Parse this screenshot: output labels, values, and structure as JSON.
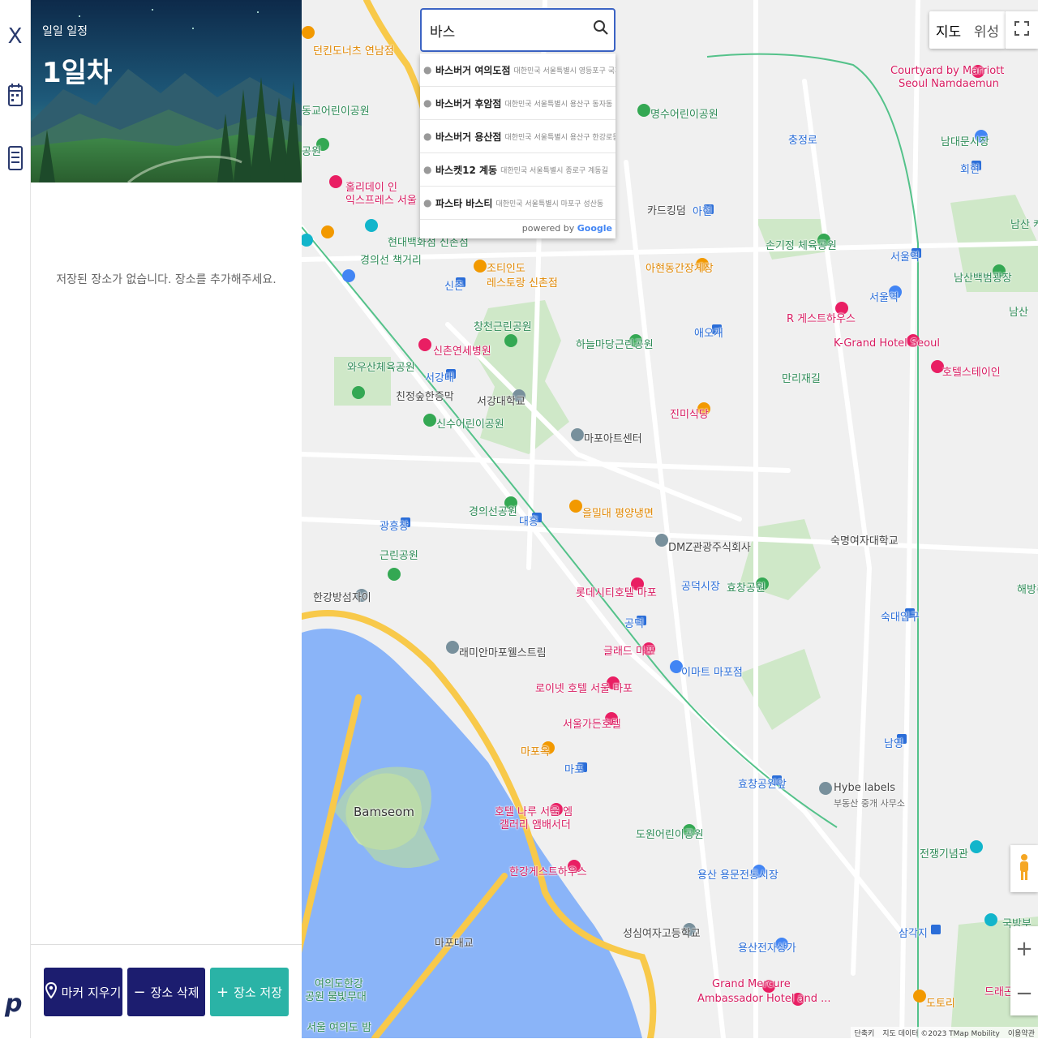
{
  "rail": {
    "close_label": "X",
    "logo": "p"
  },
  "panel": {
    "subtitle": "일일 일정",
    "title": "1일차",
    "empty_message": "저장된 장소가 없습니다. 장소를 추가해주세요.",
    "buttons": {
      "clear_markers": "마커 지우기",
      "delete_place": "장소 삭제",
      "save_place": "장소 저장"
    }
  },
  "search": {
    "value": "바스",
    "suggestions": [
      {
        "name": "바스버거 여의도점",
        "address": "대한민국 서울특별시 영등포구 국제금융로"
      },
      {
        "name": "바스버거 후암점",
        "address": "대한민국 서울특별시 용산구 동자동"
      },
      {
        "name": "바스버거 용산점",
        "address": "대한민국 서울특별시 용산구 한강로동 한강..."
      },
      {
        "name": "바스켓12 계동",
        "address": "대한민국 서울특별시 종로구 계동길"
      },
      {
        "name": "파스타 바스티",
        "address": "대한민국 서울특별시 마포구 성산동"
      }
    ],
    "powered_by": "powered by",
    "powered_brand": "Google"
  },
  "map_controls": {
    "map_label": "지도",
    "satellite_label": "위성",
    "zoom_in": "+",
    "zoom_out": "−"
  },
  "attribution": {
    "shortcuts": "단축키",
    "data": "지도 데이터 ©2023 TMap Mobility",
    "terms": "이용약관"
  },
  "map_labels": {
    "dunkin": "던킨도너츠 연남점",
    "donggyo": "동교어린이공원",
    "park_short": "공원",
    "holiday_inn_1": "홀리데이 인",
    "holiday_inn_2": "익스프레스 서울 홍대",
    "hyundai": "현대백화점 신촌점",
    "gyeongui": "경의선 책거리",
    "sinchon": "신촌",
    "sinchon_sev": "신촌연세병원",
    "sogang_univ_stn": "서강대",
    "wausan": "와우산체육공원",
    "chinjeong": "친정숲한증막",
    "sinsu": "신수어린이공원",
    "gwangheungchang": "광흥창",
    "geunrin": "근린공원",
    "hangang_park": "한강방섬자이",
    "bamseom": "Bamseom",
    "raemian": "래미안마포웰스트림",
    "mapodaegyo": "마포대교",
    "yeouido_park_1": "여의도한강",
    "yeouido_park_2": "공원 물빛무대",
    "yeouido_bottom": "서울 여의도 밤",
    "myeongsu": "명수어린이공원",
    "cardking": "카드킹덤",
    "ahyeon": "아현",
    "ahyeon_gansik": "아현동간장게장",
    "jotin": "조티인도",
    "jotin2": "레스토랑 신촌점",
    "changcheon": "창천근린공원",
    "hanulmadang": "하늘마당근린공원",
    "sogang_univ": "서강대학교",
    "mapo_art": "마포아트센터",
    "gyeongui_park": "경의선공원",
    "daeheung": "대흥",
    "eulmildae": "을밀대 평양냉면",
    "dmz": "DMZ관광주식회사",
    "gongdeok_market": "공덕시장",
    "lotte_city": "롯데시티호텔 마포",
    "gongdeok": "공덕",
    "glad": "글래드 마포",
    "emart": "이마트 마포점",
    "loisir": "로이넷 호텔 서울 마포",
    "seoul_garden": "서울가든호텔",
    "mapo_ok": "마포옥",
    "mapo": "마포",
    "hotel_naru_1": "호텔 나루 서울 엠",
    "hotel_naru_2": "갤러리 앰배서더",
    "hangang_guest": "한강게스트하우스",
    "dowon": "도원어린이공원",
    "yongsan_yongmun": "용산 용문전통시장",
    "seongsim": "성심여자고등학교",
    "yongsan_jeonja": "용산전자상가",
    "grand_mercure_1": "Grand Mercure",
    "grand_mercure_2": "Ambassador Hotel and ...",
    "chungjeongno": "충정로",
    "sonkijeong": "손기정 체육공원",
    "seoul_station": "서울역",
    "r_guest": "R 게스트하우스",
    "k_grand": "K-Grand Hotel Seoul",
    "hotel_stay": "호텔스테이인",
    "jinmi": "진미식당",
    "aeogae": "애오개",
    "manlijae": "만리재길",
    "sookmyung": "숙명여자대학교",
    "hyochang_park": "효창공원",
    "sookdae": "숙대입구",
    "namyeong": "남영",
    "hyochang_stn": "효창공원앞",
    "hybe": "Hybe labels",
    "hybe_sub": "부동산 중개 사무소",
    "war_memorial": "전쟁기념관",
    "samgakji": "삼각지",
    "national_museum": "국방부",
    "dorori": "도토리",
    "courtyard_1": "Courtyard by Marriott",
    "courtyard_2": "Seoul Namdaemun",
    "namdaemun": "남대문시장",
    "hoehyeon": "회현",
    "seoul_stn_m": "서울역",
    "namsan_bak": "남산백범광장",
    "namsan": "남산",
    "namsan_2": "남산 케이",
    "haebang": "해방촌",
    "dragon_hill": "드래곤힐 릿"
  }
}
